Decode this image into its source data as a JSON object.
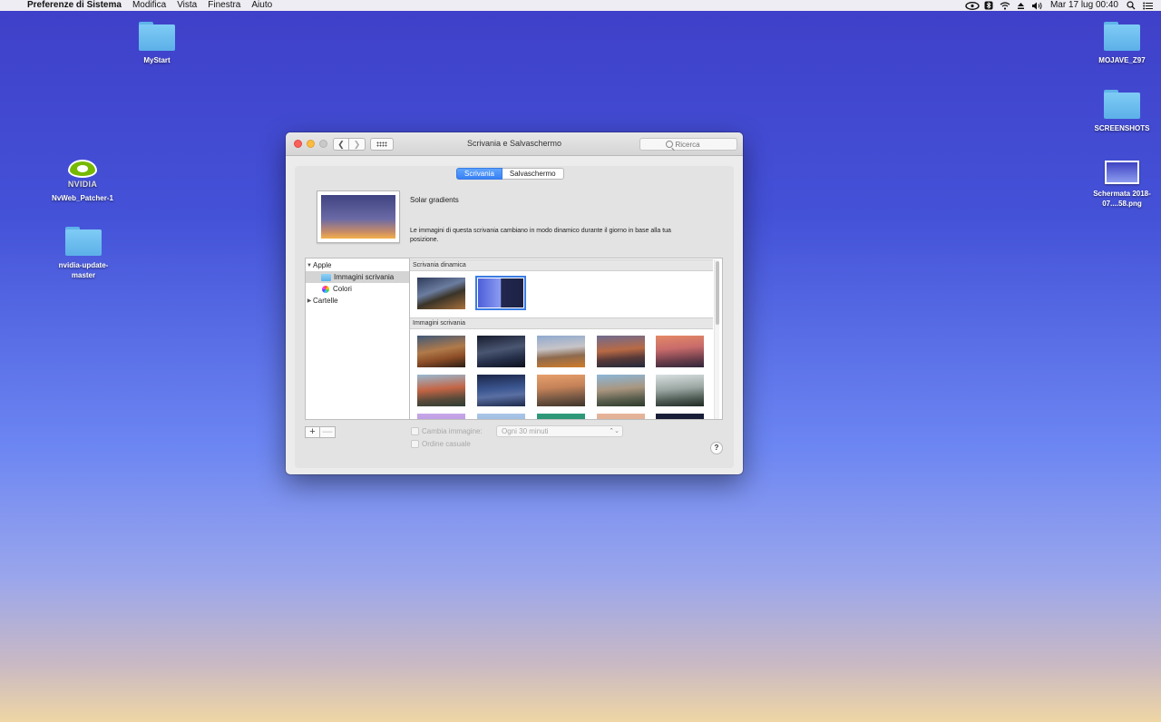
{
  "menubar": {
    "apple_icon": "apple-icon",
    "app_name": "Preferenze di Sistema",
    "menus": [
      "Modifica",
      "Vista",
      "Finestra",
      "Aiuto"
    ],
    "datetime": "Mar 17 lug  00:40",
    "status_icons": [
      "nvidia-icon",
      "bluetooth-icon",
      "wifi-icon",
      "eject-icon",
      "volume-icon",
      "search-icon",
      "list-icon"
    ]
  },
  "desktop": {
    "left_icons": [
      {
        "label": "MyStart",
        "type": "folder"
      },
      {
        "label": "NvWeb_Patcher-1",
        "type": "app"
      },
      {
        "label": "nvidia-update-master",
        "type": "folder"
      }
    ],
    "right_icons": [
      {
        "label": "MOJAVE_Z97",
        "type": "folder"
      },
      {
        "label": "SCREENSHOTS",
        "type": "folder"
      },
      {
        "label": "Schermata 2018-07....58.png",
        "type": "image"
      }
    ]
  },
  "window": {
    "title": "Scrivania e Salvaschermo",
    "search_placeholder": "Ricerca",
    "tabs": [
      "Scrivania",
      "Salvaschermo"
    ],
    "active_tab": "Scrivania",
    "preview": {
      "name": "Solar gradients",
      "description": "Le immagini di questa scrivania cambiano in modo dinamico durante il giorno in base alla tua posizione."
    },
    "sidebar": {
      "apple": "Apple",
      "desktop_pictures": "Immagini scrivania",
      "colors": "Colori",
      "folders": "Cartelle"
    },
    "gallery": {
      "dynamic_header": "Scrivania dinamica",
      "pictures_header": "Immagini scrivania"
    },
    "change_picture_label": "Cambia immagine:",
    "interval_value": "Ogni 30 minuti",
    "random_order_label": "Ordine casuale",
    "add_label": "+",
    "remove_label": "—",
    "help_label": "?"
  },
  "colors": {
    "accent": "#3880f6",
    "close": "#fc605b",
    "minimize": "#fdbc40"
  }
}
